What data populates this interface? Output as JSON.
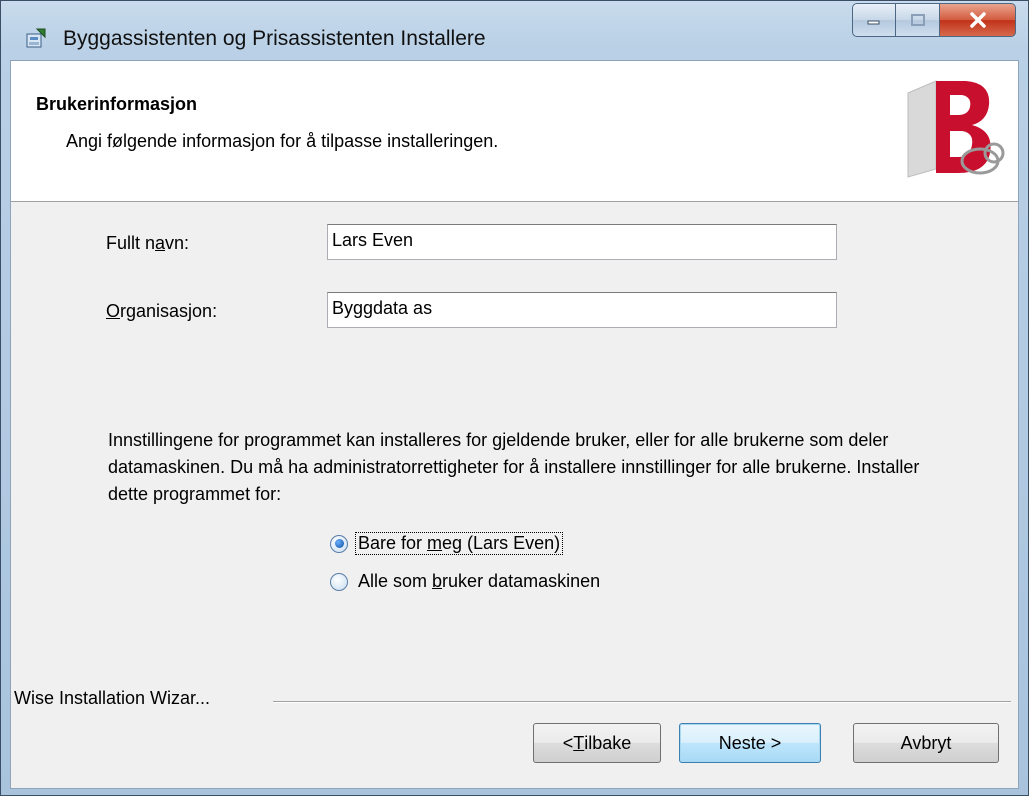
{
  "window": {
    "title": "Byggassistenten og Prisassistenten Installere",
    "controls": {
      "minimize_icon": "minimize-icon",
      "maximize_icon": "maximize-icon",
      "close_icon": "close-icon"
    }
  },
  "banner": {
    "title": "Brukerinformasjon",
    "subtitle": "Angi følgende informasjon for å tilpasse installeringen.",
    "logo_icon": "byggdata-logo",
    "logo_color": "#c8102e"
  },
  "form": {
    "full_name": {
      "label_pre": "Fullt n",
      "label_key": "a",
      "label_post": "vn:",
      "value": "Lars Even"
    },
    "organization": {
      "label_pre": "",
      "label_key": "O",
      "label_post": "rganisasjon:",
      "value": "Byggdata as"
    }
  },
  "install_scope": {
    "description": "Innstillingene for programmet kan installeres for gjeldende bruker, eller for alle brukerne som deler datamaskinen. Du må ha administratorrettigheter for å installere innstillinger for alle brukerne. Installer dette programmet for:",
    "options": [
      {
        "label_pre": "Bare for ",
        "label_key": "m",
        "label_post": "eg (Lars Even)",
        "selected": true
      },
      {
        "label_pre": "Alle som ",
        "label_key": "b",
        "label_post": "ruker datamaskinen",
        "selected": false
      }
    ]
  },
  "footer": {
    "brand": "Wise Installation Wizar...",
    "back": {
      "pre": "< ",
      "key": "T",
      "post": "ilbake"
    },
    "next_label": "Neste >",
    "cancel_label": "Avbryt"
  }
}
